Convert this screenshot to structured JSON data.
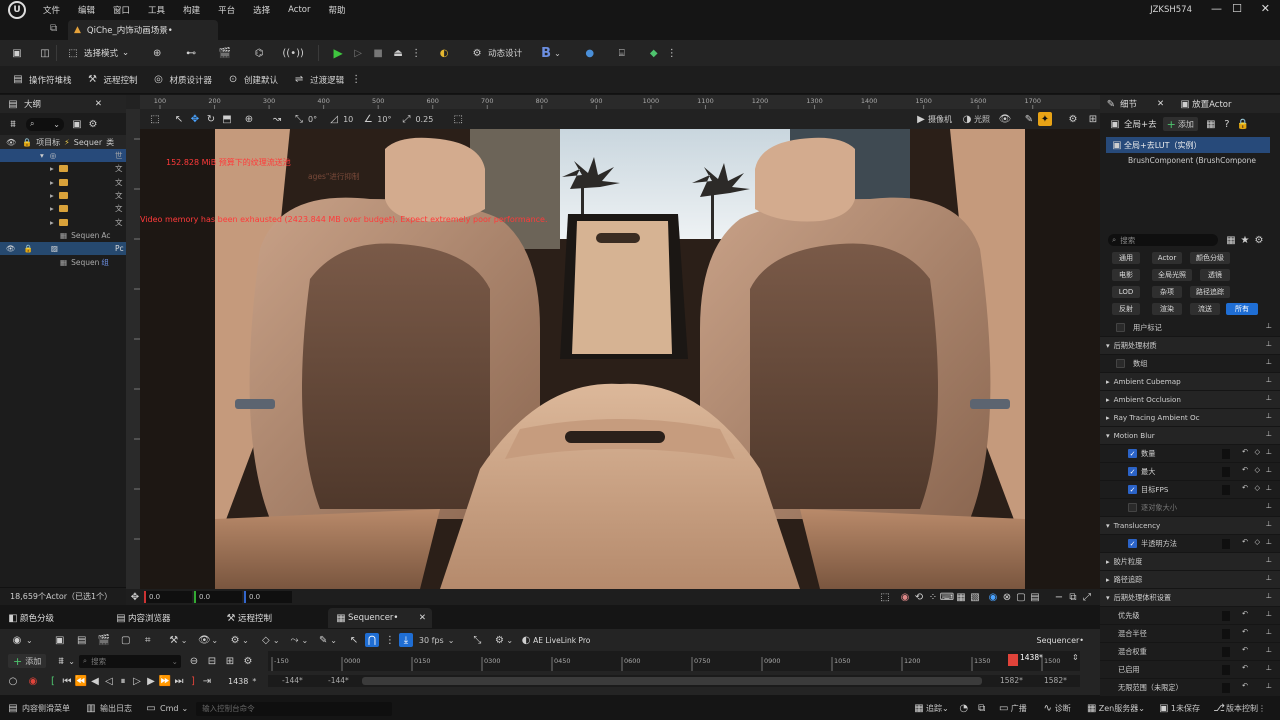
{
  "menubar": {
    "items": [
      "文件",
      "编辑",
      "窗口",
      "工具",
      "构建",
      "平台",
      "选择",
      "Actor",
      "帮助"
    ],
    "user": "JZKSH574"
  },
  "tab": {
    "title": "QiChe_内饰动画场景•"
  },
  "toolbar1": {
    "select_mode": "选择模式",
    "dynamic_design": "动态设计",
    "b_label": "B"
  },
  "toolbar2": {
    "items": [
      "操作符堆栈",
      "远程控制",
      "材质设计器",
      "创建默认",
      "过渡逻辑"
    ]
  },
  "outliner": {
    "title": "大纲",
    "col_label": "项目标",
    "col_seq": "Sequer",
    "col_type": "类",
    "rows": [
      {
        "label": "世"
      },
      {
        "label": "文"
      },
      {
        "label": "文"
      },
      {
        "label": "文"
      },
      {
        "label": "文"
      },
      {
        "label": "文"
      },
      {
        "label": "Sequen",
        "type": "Ac"
      },
      {
        "label": "Pc"
      },
      {
        "label": "Sequen",
        "type": "组"
      }
    ],
    "footer": "18,659个Actor（已选1个）"
  },
  "viewport": {
    "ruler_ticks": [
      "100",
      "200",
      "300",
      "400",
      "500",
      "600",
      "700",
      "800",
      "900",
      "1000",
      "1100",
      "1200",
      "1300",
      "1400",
      "1500",
      "1600",
      "1700"
    ],
    "camera": "摄像机",
    "lighting": "光照",
    "snap1": "0°",
    "snap2": "10",
    "snap3": "10°",
    "scale": "0.25",
    "warning1": "152.828 MiB 预算下的纹理流送池",
    "warning1b": "ages\"进行抑制",
    "warning2": "Video memory has been exhausted (2423.844 MB over budget). Expect extremely poor performance.",
    "coords": [
      "0.0",
      "0.0",
      "0.0"
    ]
  },
  "details": {
    "tab1": "细节",
    "tab2": "放置Actor",
    "actor_name": "全局+去",
    "add_label": "添加",
    "selected": "全局+去LUT（实例）",
    "component": "BrushComponent (BrushCompone",
    "search_placeholder": "搜索",
    "chips": [
      "通用",
      "Actor",
      "颜色分级",
      "电影",
      "全局光照",
      "透镜",
      "LOD",
      "杂项",
      "路径追踪",
      "反射",
      "渲染",
      "流送",
      "所有"
    ],
    "rows": [
      {
        "label": "用户标记",
        "type": "sub"
      },
      {
        "label": "后期处理材质",
        "type": "group"
      },
      {
        "label": "数组",
        "type": "sub"
      },
      {
        "label": "Ambient Cubemap",
        "type": "collapsed"
      },
      {
        "label": "Ambient Occlusion",
        "type": "collapsed"
      },
      {
        "label": "Ray Tracing Ambient Oc",
        "type": "collapsed"
      },
      {
        "label": "Motion Blur",
        "type": "group"
      },
      {
        "label": "数量",
        "type": "check"
      },
      {
        "label": "最大",
        "type": "check"
      },
      {
        "label": "目标FPS",
        "type": "check"
      },
      {
        "label": "逐对象大小",
        "type": "checkoff"
      },
      {
        "label": "Translucency",
        "type": "group"
      },
      {
        "label": "半透明方法",
        "type": "check"
      },
      {
        "label": "胶片粒度",
        "type": "collapsed"
      },
      {
        "label": "路径追踪",
        "type": "collapsed"
      },
      {
        "label": "后期处理体积设置",
        "type": "group"
      },
      {
        "label": "优先级",
        "type": "plain"
      },
      {
        "label": "混合半径",
        "type": "plain"
      },
      {
        "label": "混合权重",
        "type": "plain"
      },
      {
        "label": "已启用",
        "type": "plain"
      },
      {
        "label": "无限范围（未限定）",
        "type": "plain"
      }
    ]
  },
  "bottom_tabs": [
    "颜色分级",
    "内容浏览器",
    "远程控制",
    "Sequencer•"
  ],
  "sequencer": {
    "add_label": "添加",
    "search_placeholder": "搜索",
    "fps": "30 fps",
    "livelink": "AE LiveLink Pro",
    "title": "Sequencer•",
    "timeline_ticks": [
      "-150",
      "0000",
      "0150",
      "0300",
      "0450",
      "0600",
      "0750",
      "0900",
      "1050",
      "1200",
      "1350",
      "1500"
    ],
    "current_frame": "1438",
    "playhead": "1438*",
    "range_start": "-144*",
    "range_start2": "-144*",
    "range_end": "1582*",
    "range_end2": "1582*"
  },
  "statusbar": {
    "content_drawer": "内容侧滑菜单",
    "output_log": "输出日志",
    "cmd": "Cmd",
    "cmd_placeholder": "输入控制台命令",
    "trace": "追踪",
    "broadcast": "广播",
    "diagnose": "诊断",
    "zen": "Zen服务器",
    "save": "1未保存",
    "version": "版本控制"
  }
}
